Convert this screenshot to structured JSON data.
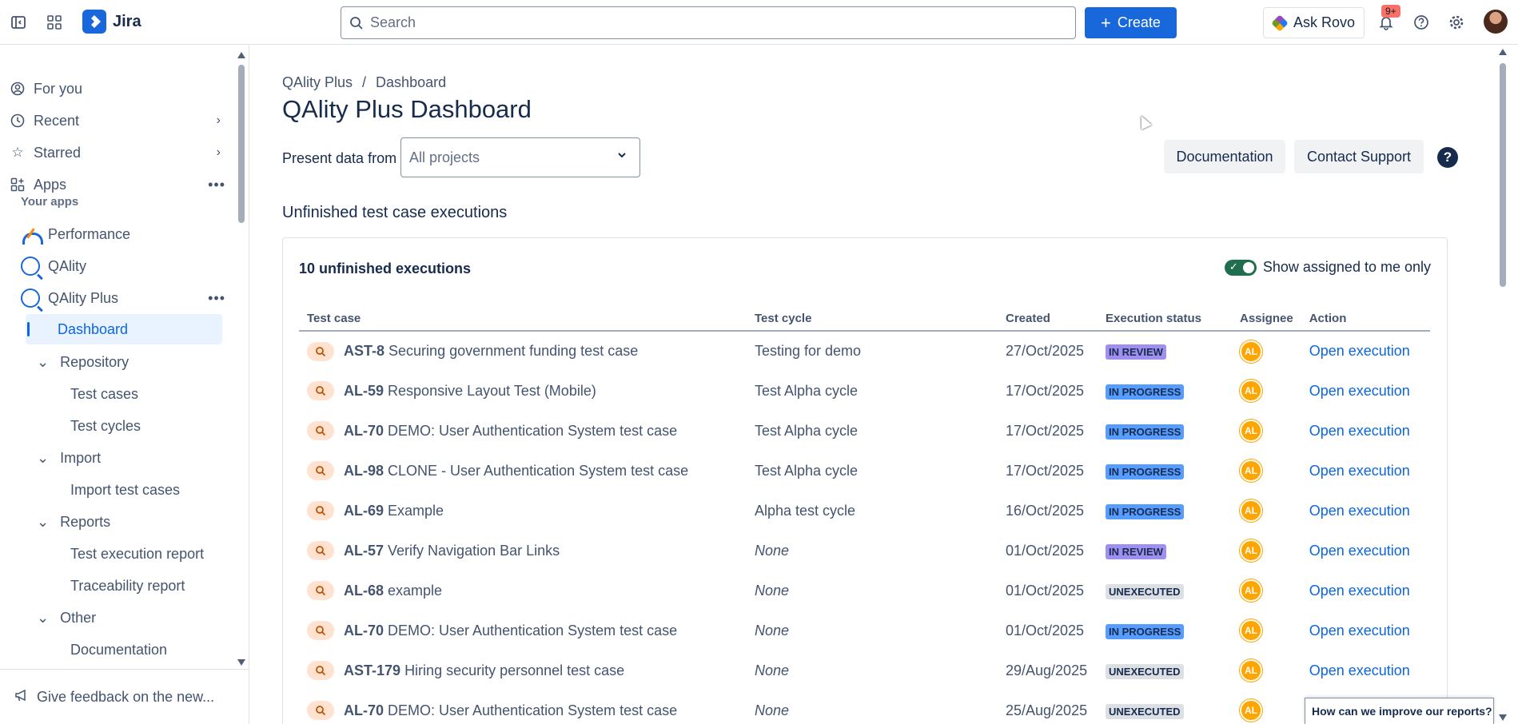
{
  "topbar": {
    "app_name": "Jira",
    "search_placeholder": "Search",
    "create_label": "Create",
    "rovo_label": "Ask Rovo",
    "notif_count": "9+"
  },
  "sidebar": {
    "top_items": [
      {
        "label": "For you",
        "icon": "user-circle-icon"
      },
      {
        "label": "Recent",
        "icon": "clock-icon"
      },
      {
        "label": "Starred",
        "icon": "star-icon"
      },
      {
        "label": "Apps",
        "icon": "apps-icon"
      }
    ],
    "your_apps_label": "Your apps",
    "apps": [
      {
        "label": "Performance"
      },
      {
        "label": "QAlity"
      },
      {
        "label": "QAlity Plus"
      }
    ],
    "dashboard_label": "Dashboard",
    "groups": {
      "repository": "Repository",
      "test_cases": "Test cases",
      "test_cycles": "Test cycles",
      "import": "Import",
      "import_test_cases": "Import test cases",
      "reports": "Reports",
      "test_execution_report": "Test execution report",
      "traceability_report": "Traceability report",
      "other": "Other",
      "documentation": "Documentation"
    },
    "feedback_label": "Give feedback on the new..."
  },
  "main": {
    "breadcrumb": [
      "QAlity Plus",
      "/",
      "Dashboard"
    ],
    "title": "QAlity Plus Dashboard",
    "present_label": "Present data from",
    "select_value": "All projects",
    "documentation_btn": "Documentation",
    "contact_btn": "Contact Support",
    "help_glyph": "?",
    "section_title": "Unfinished test case executions",
    "card_title": "10 unfinished executions",
    "toggle_label": "Show assigned to me only",
    "table": {
      "headers": [
        "Test case",
        "Test cycle",
        "Created",
        "Execution status",
        "Assignee",
        "Action"
      ],
      "rows": [
        {
          "key": "AST-8",
          "name": "Securing government funding test case",
          "cycle": "Testing for demo",
          "created": "27/Oct/2025",
          "status": "IN REVIEW",
          "assignee": "AL",
          "action": "Open execution"
        },
        {
          "key": "AL-59",
          "name": "Responsive Layout Test (Mobile)",
          "cycle": "Test Alpha cycle",
          "created": "17/Oct/2025",
          "status": "IN PROGRESS",
          "assignee": "AL",
          "action": "Open execution"
        },
        {
          "key": "AL-70",
          "name": "DEMO: User Authentication System test case",
          "cycle": "Test Alpha cycle",
          "created": "17/Oct/2025",
          "status": "IN PROGRESS",
          "assignee": "AL",
          "action": "Open execution"
        },
        {
          "key": "AL-98",
          "name": "CLONE - User Authentication System test case",
          "cycle": "Test Alpha cycle",
          "created": "17/Oct/2025",
          "status": "IN PROGRESS",
          "assignee": "AL",
          "action": "Open execution"
        },
        {
          "key": "AL-69",
          "name": "Example",
          "cycle": "Alpha test cycle",
          "created": "16/Oct/2025",
          "status": "IN PROGRESS",
          "assignee": "AL",
          "action": "Open execution"
        },
        {
          "key": "AL-57",
          "name": "Verify Navigation Bar Links",
          "cycle": "None",
          "created": "01/Oct/2025",
          "status": "IN REVIEW",
          "assignee": "AL",
          "action": "Open execution"
        },
        {
          "key": "AL-68",
          "name": "example",
          "cycle": "None",
          "created": "01/Oct/2025",
          "status": "UNEXECUTED",
          "assignee": "AL",
          "action": "Open execution"
        },
        {
          "key": "AL-70",
          "name": "DEMO: User Authentication System test case",
          "cycle": "None",
          "created": "01/Oct/2025",
          "status": "IN PROGRESS",
          "assignee": "AL",
          "action": "Open execution"
        },
        {
          "key": "AST-179",
          "name": "Hiring security personnel test case",
          "cycle": "None",
          "created": "29/Aug/2025",
          "status": "UNEXECUTED",
          "assignee": "AL",
          "action": "Open execution"
        },
        {
          "key": "AL-70",
          "name": "DEMO: User Authentication System test case",
          "cycle": "None",
          "created": "25/Aug/2025",
          "status": "UNEXECUTED",
          "assignee": "AL",
          "action": "Open execution"
        }
      ]
    },
    "improve_popup": "How can we improve our reports?"
  },
  "colors": {
    "brand": "#1868DB",
    "in_review": "#9F8FEF",
    "in_progress": "#579DFF",
    "unexecuted": "#DCDFE4",
    "assignee": "#FFA500",
    "toggle_on": "#216E4E"
  }
}
